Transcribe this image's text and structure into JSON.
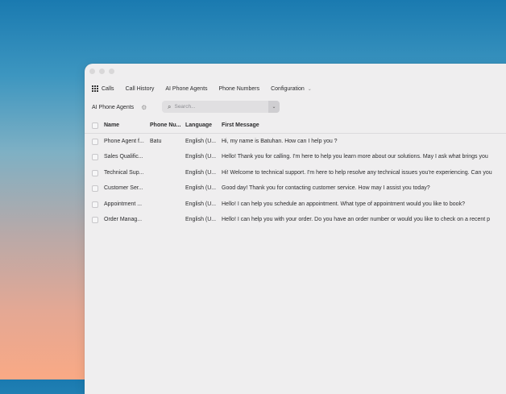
{
  "nav": {
    "items": [
      {
        "label": "Calls"
      },
      {
        "label": "Call History"
      },
      {
        "label": "AI Phone Agents"
      },
      {
        "label": "Phone Numbers"
      },
      {
        "label": "Configuration"
      }
    ]
  },
  "toolbar": {
    "title": "AI Phone Agents",
    "search_placeholder": "Search..."
  },
  "table": {
    "headers": {
      "name": "Name",
      "phone": "Phone Nu...",
      "language": "Language",
      "first_message": "First Message"
    },
    "rows": [
      {
        "name": "Phone Agent f...",
        "phone": "Batu",
        "language": "English (U...",
        "first_message": "Hi, my name is Batuhan. How can I help you ?"
      },
      {
        "name": "Sales Qualific...",
        "phone": "",
        "language": "English (U...",
        "first_message": "Hello! Thank you for calling. I'm here to help you learn more about our solutions. May I ask what brings you"
      },
      {
        "name": "Technical Sup...",
        "phone": "",
        "language": "English (U...",
        "first_message": "Hi! Welcome to technical support. I'm here to help resolve any technical issues you're experiencing. Can you"
      },
      {
        "name": "Customer Ser...",
        "phone": "",
        "language": "English (U...",
        "first_message": "Good day! Thank you for contacting customer service. How may I assist you today?"
      },
      {
        "name": "Appointment ...",
        "phone": "",
        "language": "English (U...",
        "first_message": "Hello! I can help you schedule an appointment. What type of appointment would you like to book?"
      },
      {
        "name": "Order Manag...",
        "phone": "",
        "language": "English (U...",
        "first_message": "Hello! I can help you with your order. Do you have an order number or would you like to check on a recent p"
      }
    ]
  }
}
